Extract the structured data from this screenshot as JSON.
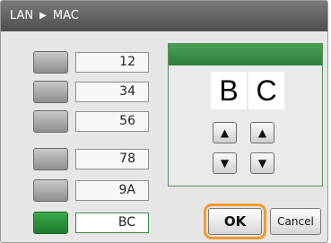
{
  "title": {
    "left": "LAN",
    "right": "MAC",
    "separator_icon": "triangle-right"
  },
  "rows": [
    {
      "value": "12",
      "active": false
    },
    {
      "value": "34",
      "active": false
    },
    {
      "value": "56",
      "active": false
    },
    {
      "value": "78",
      "active": false
    },
    {
      "value": "9A",
      "active": false
    },
    {
      "value": "BC",
      "active": true
    }
  ],
  "editor": {
    "chars": [
      "B",
      "C"
    ],
    "up_icon": "▲",
    "down_icon": "▼"
  },
  "buttons": {
    "ok": "OK",
    "cancel": "Cancel"
  },
  "colors": {
    "accent_green": "#2f7f3b",
    "highlight_orange": "#f29a2c",
    "titlebar": "#5a5a5a"
  }
}
